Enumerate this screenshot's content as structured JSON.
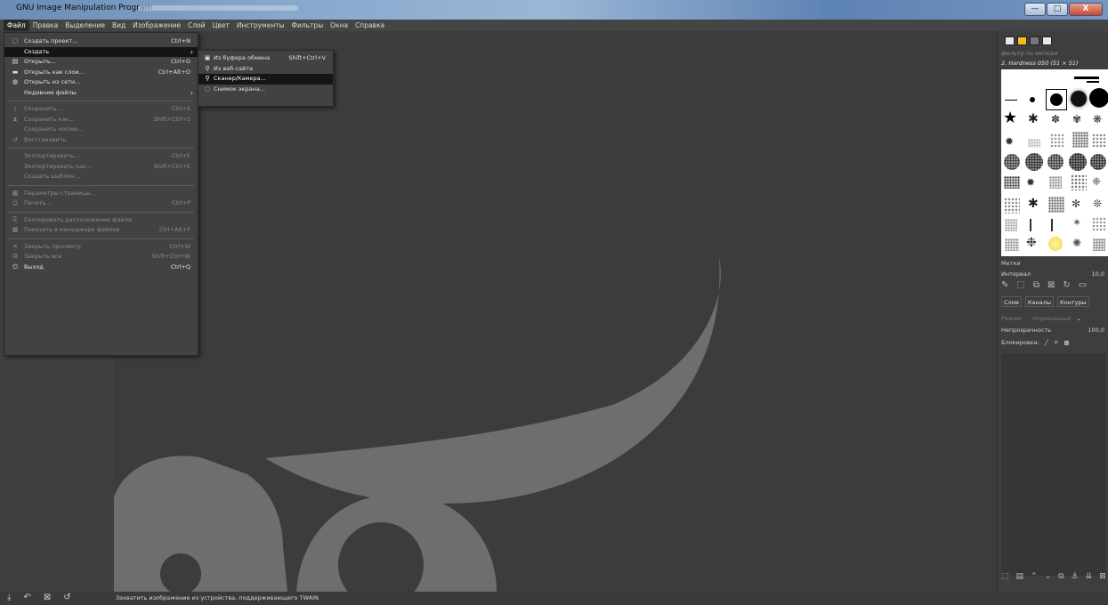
{
  "window": {
    "title": "GNU Image Manipulation Program",
    "controls": {
      "minimize": "—",
      "maximize": "□",
      "close": "X"
    }
  },
  "menubar": [
    "Файл",
    "Правка",
    "Выделение",
    "Вид",
    "Изображение",
    "Слой",
    "Цвет",
    "Инструменты",
    "Фильтры",
    "Окна",
    "Справка"
  ],
  "file_menu": {
    "items": [
      {
        "label": "Создать проект...",
        "shortcut": "Ctrl+N",
        "icon": "new-project-icon",
        "glyph": "⬚",
        "state": "normal"
      },
      {
        "label": "Создать",
        "shortcut": "",
        "icon": "",
        "glyph": "",
        "state": "highlight",
        "submenu": true
      },
      {
        "label": "Открыть...",
        "shortcut": "Ctrl+O",
        "icon": "open-icon",
        "glyph": "▤",
        "state": "normal"
      },
      {
        "label": "Открыть как слои...",
        "shortcut": "Ctrl+Alt+O",
        "icon": "open-as-layers-icon",
        "glyph": "▬",
        "state": "normal"
      },
      {
        "label": "Открыть из сети...",
        "shortcut": "",
        "icon": "open-location-icon",
        "glyph": "◍",
        "state": "normal"
      },
      {
        "label": "Недавние файлы",
        "shortcut": "",
        "icon": "",
        "glyph": "",
        "state": "normal",
        "submenu": true
      },
      {
        "sep": true
      },
      {
        "label": "Сохранить...",
        "shortcut": "Ctrl+S",
        "icon": "save-icon",
        "glyph": "⤓",
        "state": "disabled"
      },
      {
        "label": "Сохранить как...",
        "shortcut": "Shift+Ctrl+S",
        "icon": "save-as-icon",
        "glyph": "⧗",
        "state": "disabled"
      },
      {
        "label": "Сохранить копию...",
        "shortcut": "",
        "icon": "",
        "glyph": "",
        "state": "disabled"
      },
      {
        "label": "Восстановить",
        "shortcut": "",
        "icon": "revert-icon",
        "glyph": "↺",
        "state": "disabled"
      },
      {
        "sep": true
      },
      {
        "label": "Экспортировать...",
        "shortcut": "Ctrl+E",
        "icon": "",
        "glyph": "",
        "state": "disabled"
      },
      {
        "label": "Экспортировать как...",
        "shortcut": "Shift+Ctrl+E",
        "icon": "",
        "glyph": "",
        "state": "disabled"
      },
      {
        "label": "Создать шаблон...",
        "shortcut": "",
        "icon": "",
        "glyph": "",
        "state": "disabled"
      },
      {
        "sep": true
      },
      {
        "label": "Параметры страницы...",
        "shortcut": "",
        "icon": "page-setup-icon",
        "glyph": "▦",
        "state": "disabled"
      },
      {
        "label": "Печать...",
        "shortcut": "Ctrl+P",
        "icon": "print-icon",
        "glyph": "⎙",
        "state": "disabled"
      },
      {
        "sep": true
      },
      {
        "label": "Скопировать расположение файла",
        "shortcut": "",
        "icon": "copy-location-icon",
        "glyph": "⎘",
        "state": "disabled"
      },
      {
        "label": "Показать в менеджере файлов",
        "shortcut": "Ctrl+Alt+F",
        "icon": "show-in-files-icon",
        "glyph": "▩",
        "state": "disabled"
      },
      {
        "sep": true
      },
      {
        "label": "Закрыть просмотр",
        "shortcut": "Ctrl+W",
        "icon": "close-view-icon",
        "glyph": "✕",
        "state": "disabled"
      },
      {
        "label": "Закрыть все",
        "shortcut": "Shift+Ctrl+W",
        "icon": "close-all-icon",
        "glyph": "⧉",
        "state": "disabled"
      },
      {
        "label": "Выход",
        "shortcut": "Ctrl+Q",
        "icon": "quit-icon",
        "glyph": "⏻",
        "state": "normal"
      }
    ]
  },
  "create_submenu": {
    "items": [
      {
        "label": "Из буфера обмена",
        "shortcut": "Shift+Ctrl+V",
        "icon": "clipboard-icon",
        "glyph": "▣",
        "state": "normal"
      },
      {
        "label": "Из веб-сайта",
        "shortcut": "",
        "icon": "webpage-icon",
        "glyph": "⚲",
        "state": "normal"
      },
      {
        "label": "Сканер/Камера...",
        "shortcut": "",
        "icon": "scanner-icon",
        "glyph": "⚲",
        "state": "highlight"
      },
      {
        "label": "Снимок экрана...",
        "shortcut": "",
        "icon": "screenshot-icon",
        "glyph": "◌",
        "state": "normal"
      }
    ]
  },
  "right_dock": {
    "brush_filter_placeholder": "фильтр по меткам",
    "brush_name": "2. Hardness 050 (51 × 51)",
    "brush_tag": "Метки",
    "spacing_label": "Интервал",
    "spacing_value": "10,0",
    "layer_tabs": [
      "Слои",
      "Каналы",
      "Контуры"
    ],
    "mode_label": "Режим",
    "mode_value": "Нормальный",
    "opacity_label": "Непрозрачность",
    "opacity_value": "100,0",
    "lock_label": "Блокировка:"
  },
  "statusbar": {
    "message": "Захватить изображение из устройства, поддерживающего TWAIN"
  },
  "colors": {
    "canvas_bg": "#3c3c3c",
    "wilber": "#6e6e6e",
    "menu_bg": "#424242",
    "highlight": "#151515"
  }
}
